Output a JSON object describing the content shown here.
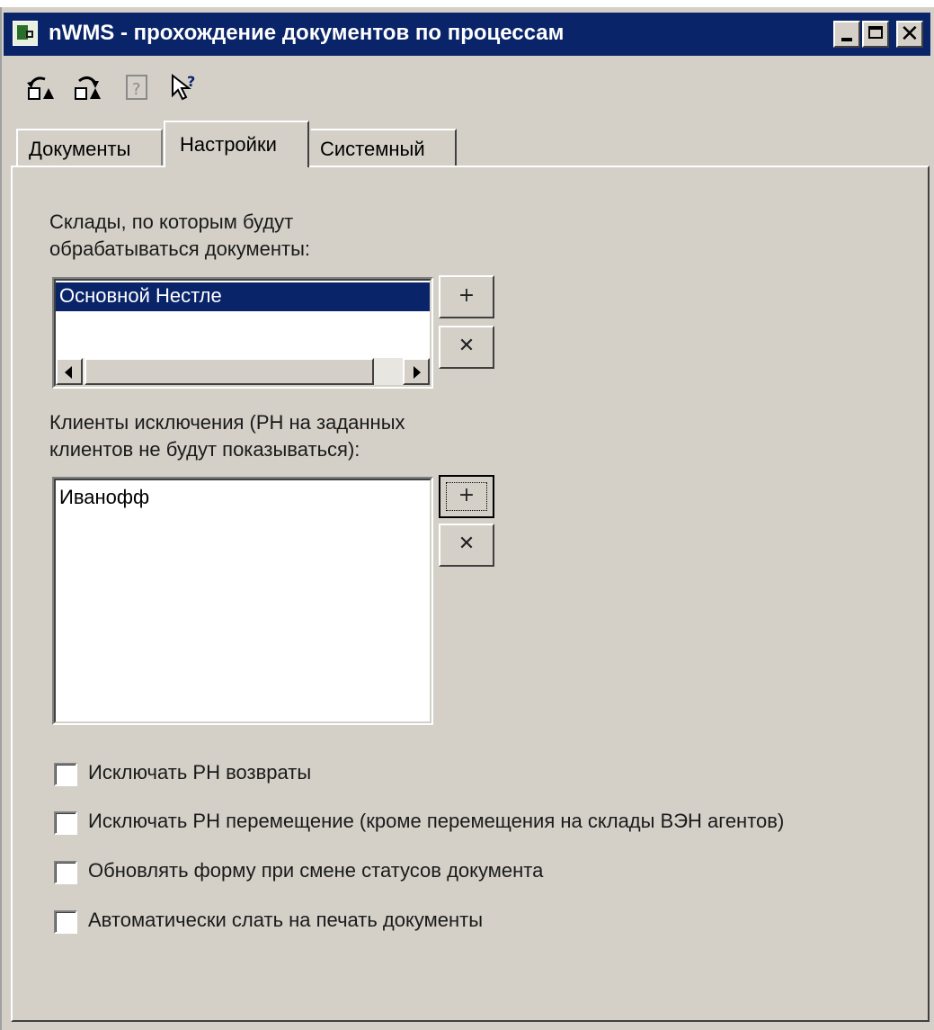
{
  "window": {
    "title": "nWMS - прохождение документов по процессам",
    "controls": [
      "minimize-icon",
      "maximize-icon",
      "close-icon"
    ]
  },
  "toolbar": {
    "icons": [
      "undo-icon",
      "redo-icon",
      "help-page-icon",
      "whats-this-icon"
    ]
  },
  "tabs": [
    {
      "label": "Документы",
      "active": false
    },
    {
      "label": "Настройки",
      "active": true
    },
    {
      "label": "Системный",
      "active": false
    }
  ],
  "settings": {
    "warehouses_label_line1": "Склады, по которым будут",
    "warehouses_label_line2": "обрабатываться документы:",
    "warehouses": [
      "Основной Нестле"
    ],
    "excluded_clients_label_line1": "Клиенты исключения (РН на заданных",
    "excluded_clients_label_line2": "клиентов не будут показываться):",
    "excluded_clients": [
      "Иванофф"
    ],
    "add_label": "+",
    "remove_label": "✕",
    "options": [
      {
        "label": "Исключать РН возвраты",
        "checked": false
      },
      {
        "label": "Исключать РН перемещение (кроме перемещения на склады ВЭН агентов)",
        "checked": false
      },
      {
        "label": "Обновлять форму при смене статусов документа",
        "checked": false
      },
      {
        "label": "Автоматически слать на печать документы",
        "checked": false
      }
    ]
  }
}
